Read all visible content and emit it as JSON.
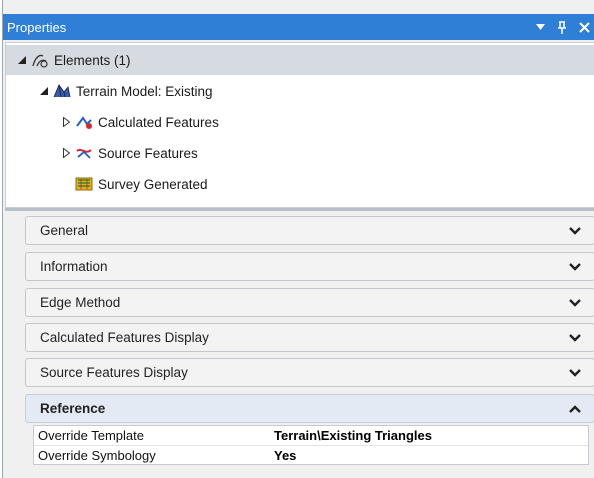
{
  "window": {
    "title": "Properties",
    "controls": {
      "dropdown": "▼",
      "pin": "📌",
      "close": "✕"
    }
  },
  "tree": {
    "root": {
      "label": "Elements (1)",
      "expanded": true,
      "icon": "elements-icon"
    },
    "terrain": {
      "label": "Terrain Model: Existing",
      "expanded": true,
      "icon": "terrain-model-icon"
    },
    "children": [
      {
        "label": "Calculated Features",
        "icon": "calculated-features-icon",
        "expandable": true
      },
      {
        "label": "Source Features",
        "icon": "source-features-icon",
        "expandable": true
      },
      {
        "label": "Survey Generated",
        "icon": "survey-generated-icon",
        "expandable": false
      }
    ]
  },
  "sections": [
    {
      "label": "General",
      "expanded": false
    },
    {
      "label": "Information",
      "expanded": false
    },
    {
      "label": "Edge Method",
      "expanded": false
    },
    {
      "label": "Calculated Features Display",
      "expanded": false
    },
    {
      "label": "Source Features Display",
      "expanded": false
    },
    {
      "label": "Reference",
      "expanded": true
    }
  ],
  "reference_properties": [
    {
      "name": "Override Template",
      "value": "Terrain\\Existing Triangles"
    },
    {
      "name": "Override Symbology",
      "value": "Yes"
    }
  ],
  "colors": {
    "titlebar": "#2f7fd6",
    "selection": "#d6dbe2",
    "expanded_section": "#e4eaf3"
  }
}
